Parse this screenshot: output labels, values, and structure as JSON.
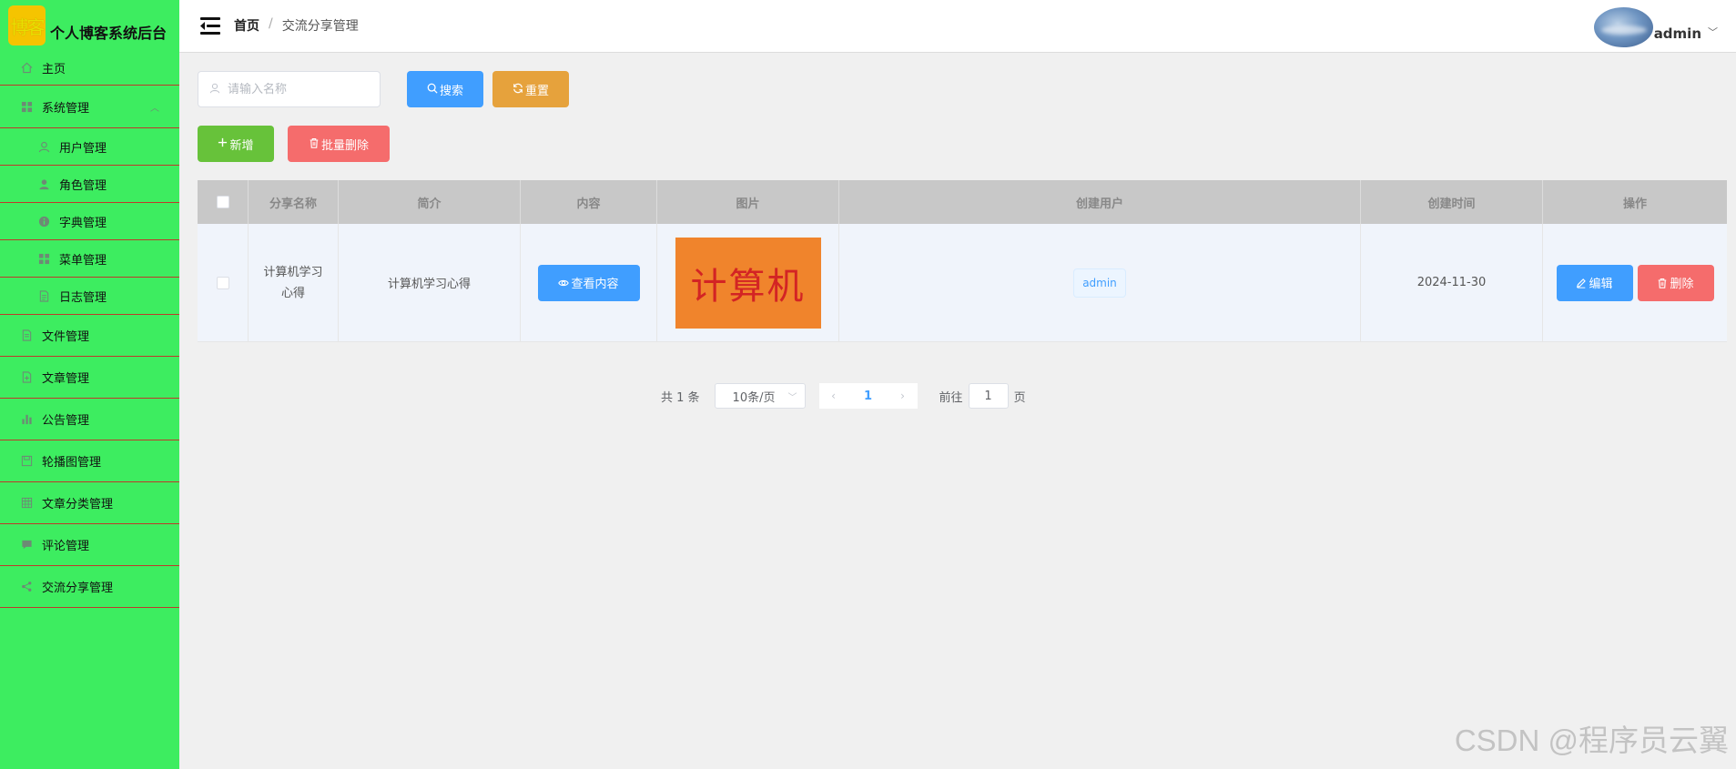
{
  "app": {
    "logo_text": "博客",
    "title": "个人博客系统后台"
  },
  "sidebar": {
    "items": [
      {
        "label": "主页",
        "icon": "home-icon"
      },
      {
        "label": "系统管理",
        "icon": "grid-icon",
        "expanded": true
      },
      {
        "label": "用户管理",
        "icon": "user-icon"
      },
      {
        "label": "角色管理",
        "icon": "user-filled-icon"
      },
      {
        "label": "字典管理",
        "icon": "info-icon"
      },
      {
        "label": "菜单管理",
        "icon": "menu-grid-icon"
      },
      {
        "label": "日志管理",
        "icon": "document-icon"
      },
      {
        "label": "文件管理",
        "icon": "file-icon"
      },
      {
        "label": "文章管理",
        "icon": "document-add-icon"
      },
      {
        "label": "公告管理",
        "icon": "bar-chart-icon"
      },
      {
        "label": "轮播图管理",
        "icon": "save-icon"
      },
      {
        "label": "文章分类管理",
        "icon": "table-icon"
      },
      {
        "label": "评论管理",
        "icon": "chat-icon"
      },
      {
        "label": "交流分享管理",
        "icon": "share-icon"
      }
    ]
  },
  "header": {
    "breadcrumb_home": "首页",
    "breadcrumb_sep": "/",
    "breadcrumb_current": "交流分享管理",
    "username": "admin"
  },
  "toolbar": {
    "search_placeholder": "请输入名称",
    "search_label": "搜索",
    "reset_label": "重置",
    "add_label": "新增",
    "batch_delete_label": "批量删除"
  },
  "table": {
    "columns": [
      "分享名称",
      "简介",
      "内容",
      "图片",
      "创建用户",
      "创建时间",
      "操作"
    ],
    "rows": [
      {
        "name": "计算机学习心得",
        "intro": "计算机学习心得",
        "view_label": "查看内容",
        "image_text": "计算机",
        "user": "admin",
        "created": "2024-11-30",
        "edit_label": "编辑",
        "delete_label": "删除"
      }
    ]
  },
  "pagination": {
    "total": "共 1 条",
    "page_size": "10条/页",
    "current_page": "1",
    "goto_prefix": "前往",
    "goto_value": "1",
    "goto_suffix": "页"
  },
  "watermark": "CSDN @程序员云翼",
  "colors": {
    "sidebar_bg": "#3ded60",
    "primary": "#409eff",
    "warning": "#e6a23c",
    "success": "#67c23a",
    "danger": "#f56c6c"
  }
}
